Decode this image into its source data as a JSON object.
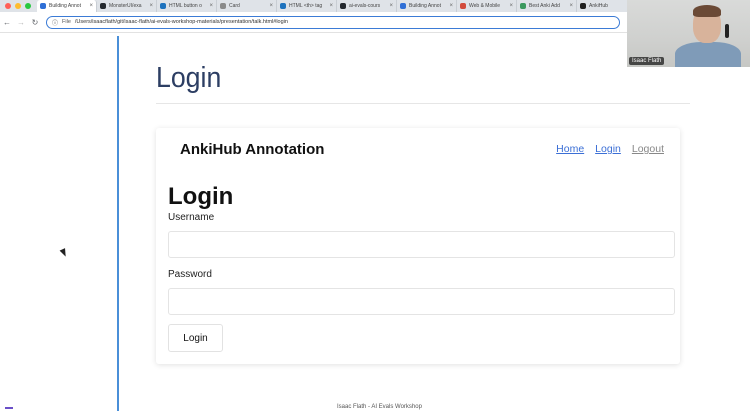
{
  "browser": {
    "tabs": [
      {
        "label": "Building Annot",
        "favicon_color": "#2f6fd6",
        "active": true
      },
      {
        "label": "MonsterUI/exa",
        "favicon_color": "#24292f",
        "active": false
      },
      {
        "label": "HTML button o",
        "favicon_color": "#1e73be",
        "active": false
      },
      {
        "label": "Card",
        "favicon_color": "#8a8a8a",
        "active": false
      },
      {
        "label": "HTML <th> tag",
        "favicon_color": "#1e73be",
        "active": false
      },
      {
        "label": "ai-evals-cours",
        "favicon_color": "#24292f",
        "active": false
      },
      {
        "label": "Building Annot",
        "favicon_color": "#2f6fd6",
        "active": false
      },
      {
        "label": "Web & Mobile",
        "favicon_color": "#d24b3c",
        "active": false
      },
      {
        "label": "Best Anki Add",
        "favicon_color": "#3c9a5f",
        "active": false
      },
      {
        "label": "AnkiHub",
        "favicon_color": "#222222",
        "active": false
      }
    ],
    "address": {
      "scheme": "File",
      "url": "/Users/isaacflath/git/isaac-flath/ai-evals-workshop-materials/presentation/talk.html#login"
    }
  },
  "slide": {
    "title": "Login",
    "footer": "Isaac Flath - AI Evals Workshop"
  },
  "app": {
    "brand": "AnkiHub Annotation",
    "nav": {
      "home": "Home",
      "login": "Login",
      "logout": "Logout"
    },
    "heading": "Login",
    "username_label": "Username",
    "username_value": "",
    "password_label": "Password",
    "password_value": "",
    "submit_label": "Login"
  },
  "webcam": {
    "name": "Isaac Flath"
  },
  "colors": {
    "accent": "#4a8fd8",
    "link": "#3b6fd6",
    "title": "#2c3e63"
  }
}
